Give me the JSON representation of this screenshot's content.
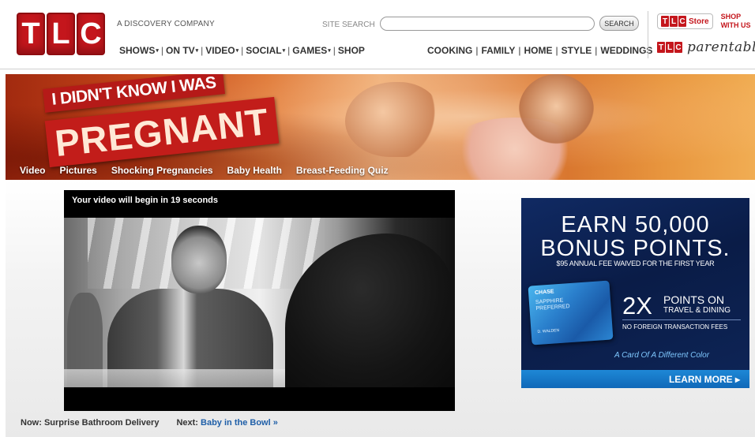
{
  "brand": {
    "logo_letters": [
      "T",
      "L",
      "C"
    ],
    "tagline": "A DISCOVERY COMPANY",
    "brand_color": "#c4161c"
  },
  "search": {
    "label": "SITE SEARCH",
    "value": "",
    "placeholder": "",
    "button_label": "SEARCH"
  },
  "main_nav": {
    "items": [
      {
        "label": "SHOWS",
        "has_dropdown": true
      },
      {
        "label": "ON TV",
        "has_dropdown": true
      },
      {
        "label": "VIDEO",
        "has_dropdown": true
      },
      {
        "label": "SOCIAL",
        "has_dropdown": true
      },
      {
        "label": "GAMES",
        "has_dropdown": true
      },
      {
        "label": "SHOP",
        "has_dropdown": false
      }
    ],
    "separator": "|",
    "caret": "▾"
  },
  "topic_nav": {
    "items": [
      "COOKING",
      "FAMILY",
      "HOME",
      "STYLE",
      "WEDDINGS"
    ],
    "separator": "|"
  },
  "promos": {
    "store_label": "Store",
    "shop_line_1": "SHOP",
    "shop_line_2": "WITH US",
    "parentables_label": "parentables"
  },
  "banner": {
    "title_top": "I DIDN'T KNOW I WAS",
    "title_main": "PREGNANT",
    "links": [
      "Video",
      "Pictures",
      "Shocking Pregnancies",
      "Baby Health",
      "Breast-Feeding Quiz"
    ]
  },
  "player": {
    "status_text": "Your video will begin in 19 seconds"
  },
  "now_next": {
    "now_label": "Now:",
    "now_title": "Surprise Bathroom Delivery",
    "next_label": "Next:",
    "next_title": "Baby in the Bowl »"
  },
  "ad": {
    "headline_1": "EARN 50,000",
    "headline_2": "BONUS POINTS.",
    "subline": "$95 ANNUAL FEE WAIVED FOR THE FIRST YEAR",
    "card_brand": "CHASE",
    "card_name_1": "SAPPHIRE",
    "card_name_2": "PREFERRED",
    "card_holder": "D. WALDEN",
    "multiplier": "2X",
    "points_line": "POINTS ON",
    "points_sub": "TRAVEL & DINING",
    "no_fee": "NO FOREIGN TRANSACTION FEES",
    "tagline": "A Card Of A Different Color",
    "cta": "LEARN MORE ▸",
    "bg_color": "#0d2152",
    "cta_color": "#1e88d6"
  }
}
